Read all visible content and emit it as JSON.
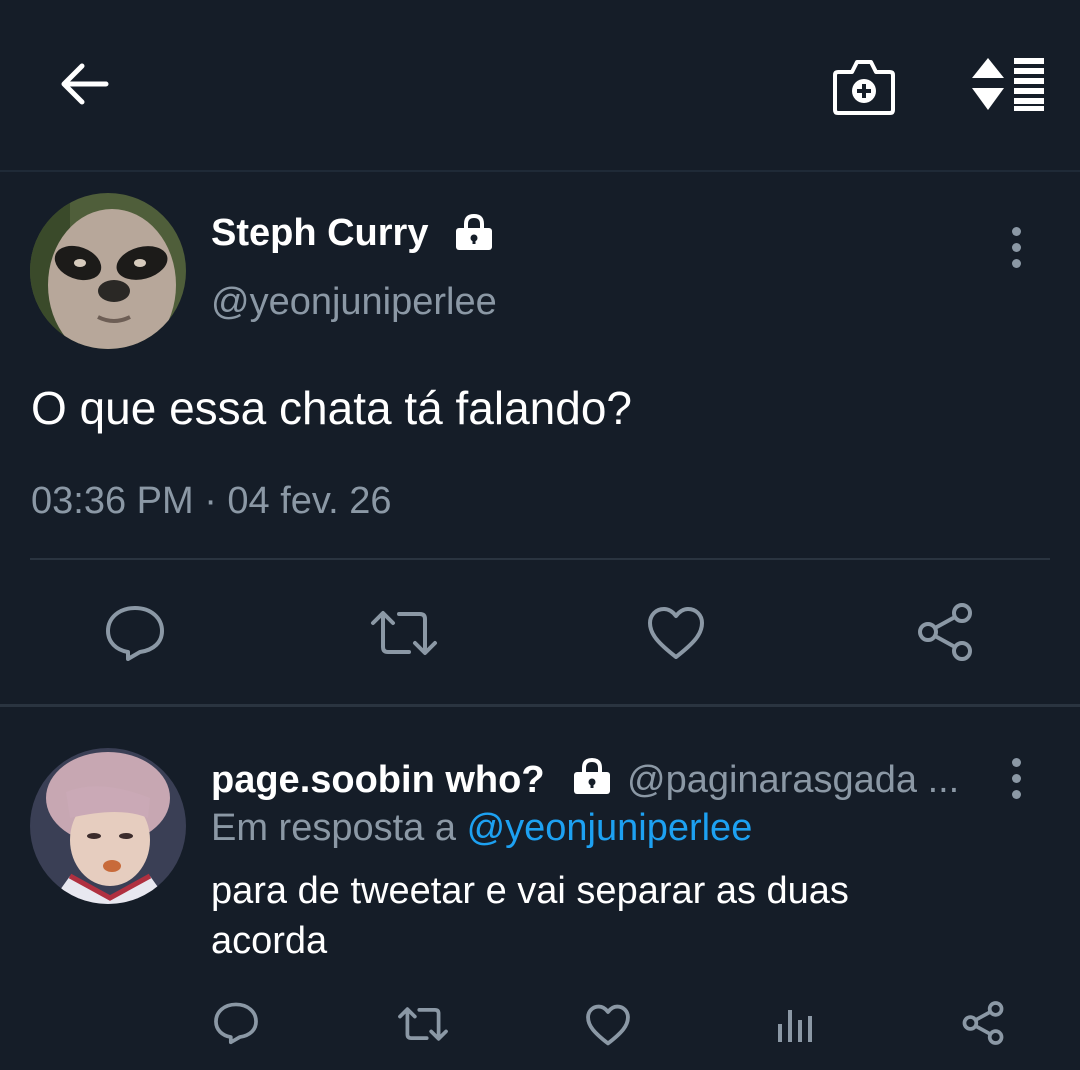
{
  "header": {
    "back_icon": "arrow-left-icon",
    "camera_icon": "camera-plus-icon",
    "sort_icon": "sort-list-icon"
  },
  "main_tweet": {
    "display_name": "Steph Curry",
    "handle": "@yeonjuniperlee",
    "text": "O que essa chata tá falando?",
    "timestamp": "03:36 PM · 04 fev. 26",
    "locked": true
  },
  "reply": {
    "display_name": "page.soobin who?",
    "handle": "@paginarasgada ...",
    "in_reply_prefix": "Em resposta a",
    "in_reply_handle": "@yeonjuniperlee",
    "text_line1": "para de tweetar e vai separar as duas",
    "text_line2": "acorda",
    "locked": true
  },
  "colors": {
    "background": "#151d28",
    "muted": "#8b98a5",
    "link": "#1da1f2"
  }
}
